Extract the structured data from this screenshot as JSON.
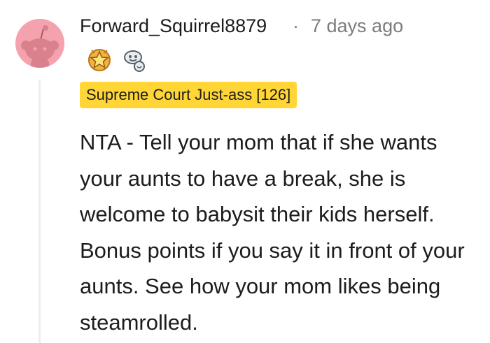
{
  "comment": {
    "username": "Forward_Squirrel8879",
    "separator": "·",
    "timestamp": "7 days ago",
    "flair": "Supreme Court Just-ass [126]",
    "body": "NTA - Tell your mom that if she wants your aunts to have a break, she is welcome to babysit their kids herself. Bonus points if you say it in front of your aunts. See how your mom likes being steamrolled.",
    "avatar_color": "#f4a3ae",
    "flair_color": "#ffd635",
    "awards": [
      {
        "icon": "gold-star-award-icon"
      },
      {
        "icon": "wholesome-award-icon"
      }
    ]
  }
}
